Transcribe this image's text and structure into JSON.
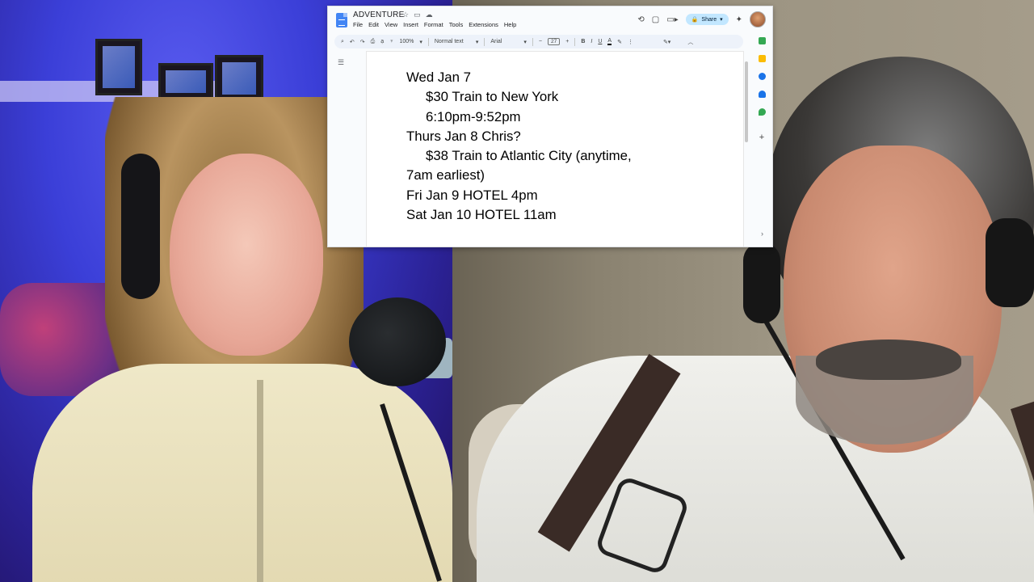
{
  "document": {
    "title": "ADVENTURE",
    "menu": [
      "File",
      "Edit",
      "View",
      "Insert",
      "Format",
      "Tools",
      "Extensions",
      "Help"
    ],
    "share_label": "Share",
    "toolbar": {
      "zoom": "100%",
      "style": "Normal text",
      "font": "Arial",
      "font_size": "27",
      "minus": "−",
      "plus": "+"
    },
    "lines": [
      "Wed Jan 7",
      "$30 Train to New York",
      "6:10pm-9:52pm",
      "Thurs Jan 8 Chris?",
      "$38 Train to Atlantic City (anytime,",
      "7am earliest)",
      "Fri Jan 9 HOTEL 4pm",
      "Sat Jan 10 HOTEL 11am"
    ]
  },
  "colors": {
    "docs_blue": "#4285f4",
    "share_bg": "#c2e7ff",
    "toolbar_bg": "#edf2fa",
    "left_background": "#3b3fd8",
    "right_background": "#9d9583"
  },
  "icons": {
    "star": "star-icon",
    "move": "move-to-folder-icon",
    "cloud": "cloud-status-icon",
    "history": "history-icon",
    "comments": "comment-icon",
    "meet": "video-call-icon",
    "gemini": "sparkle-icon",
    "side_panel": [
      "sheets-icon",
      "keep-icon",
      "tasks-icon",
      "contacts-icon",
      "maps-icon",
      "add-icon"
    ]
  }
}
